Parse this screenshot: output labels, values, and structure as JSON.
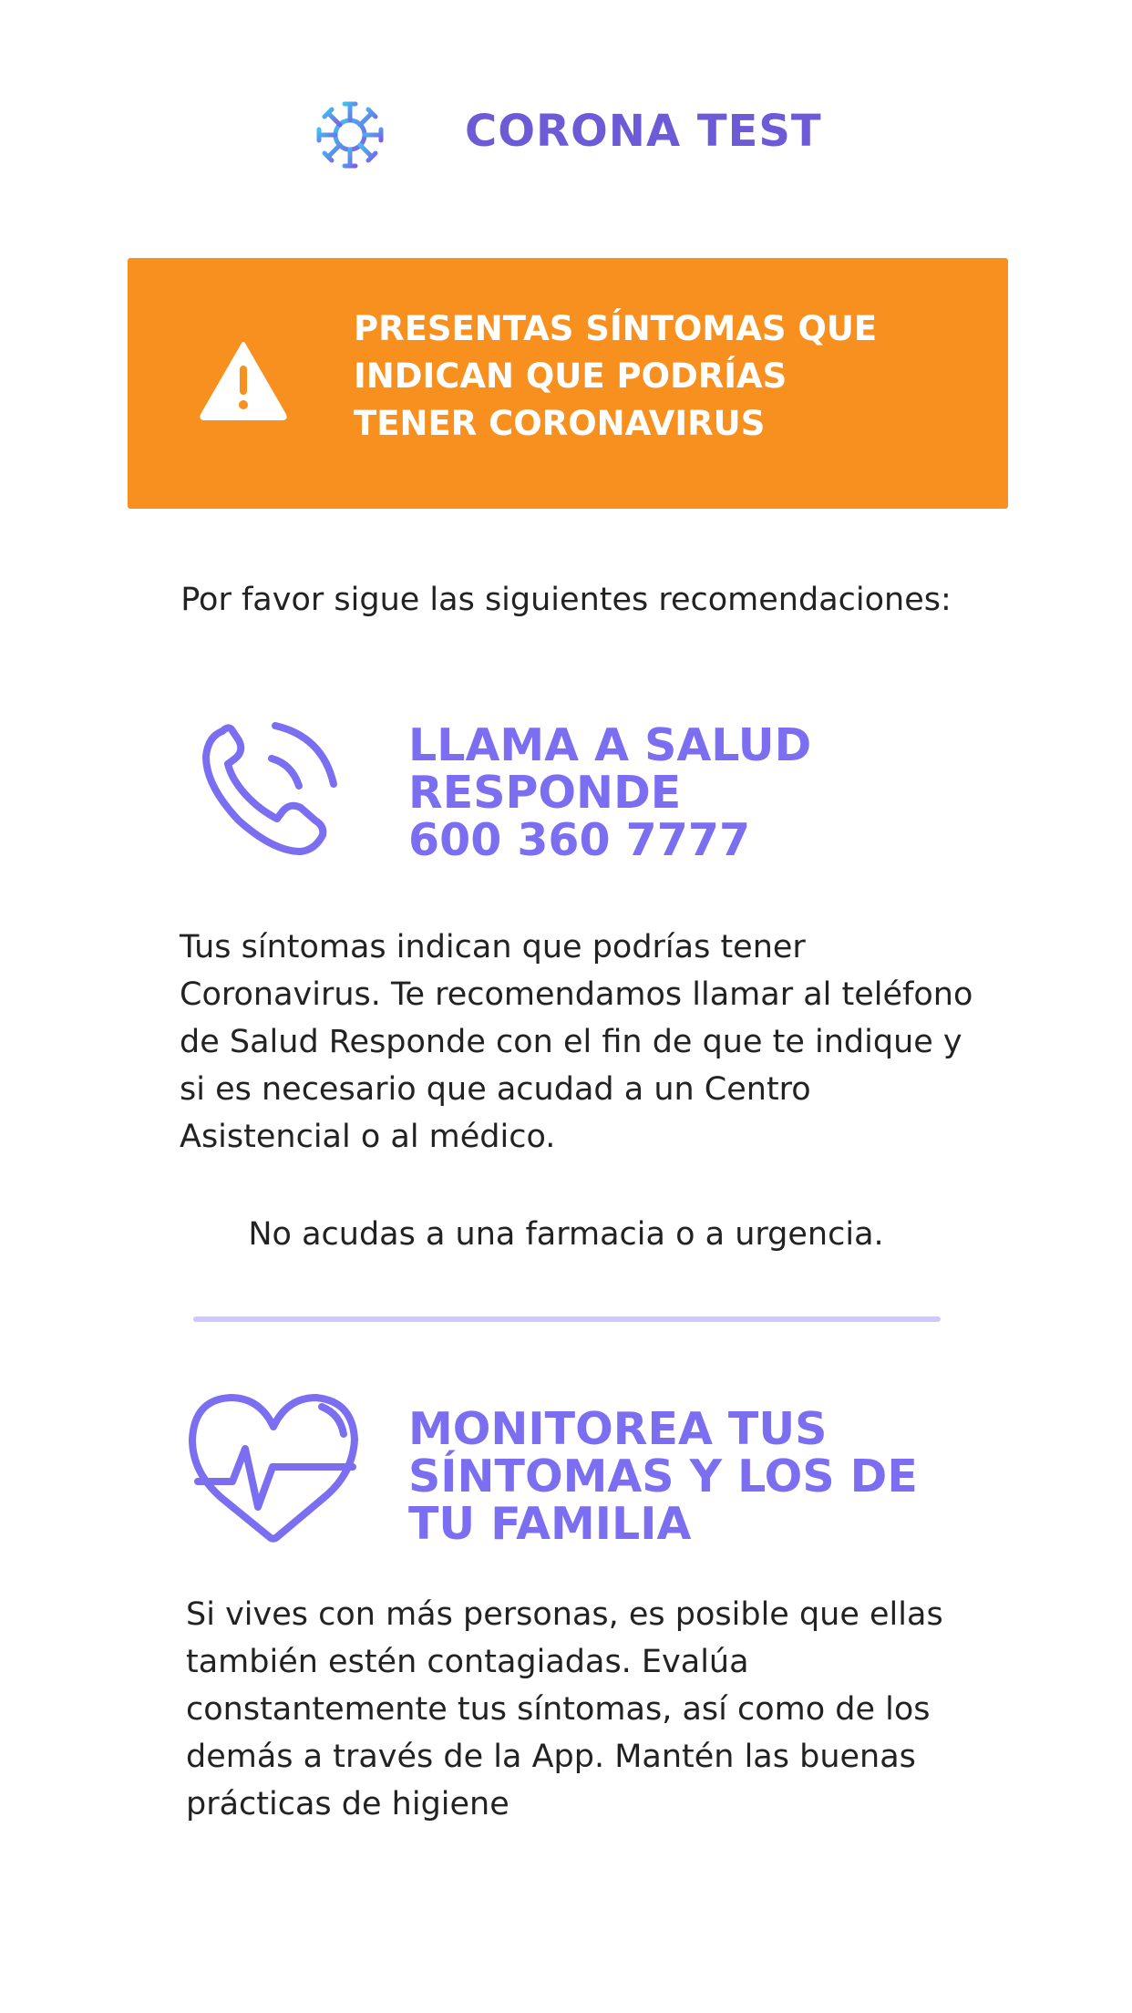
{
  "header": {
    "logo_icon": "virus-icon",
    "title": "CORONA TEST",
    "title_color": "#6c5ad6"
  },
  "alert": {
    "icon": "warning-triangle-icon",
    "message": "PRESENTAS SÍNTOMAS QUE\nINDICAN QUE PODRÍAS\nTENER CORONAVIRUS",
    "background_color": "#f7901f"
  },
  "intro": "Por favor sigue las siguientes recomendaciones:",
  "recommendations": [
    {
      "icon": "phone-call-icon",
      "title": "LLAMA A SALUD\nRESPONDE\n600 360 7777",
      "description": "Tus síntomas indican que podrías tener Coronavirus. Te recomendamos llamar al teléfono de Salud Responde con el fin de que te indique y si es necesario que acudad a un Centro Asistencial o al médico.",
      "note": "No acudas a una farmacia o a urgencia."
    },
    {
      "icon": "heart-pulse-icon",
      "title": "MONITOREA TUS\nSÍNTOMAS Y LOS DE\nTU FAMILIA",
      "description": "Si vives con más personas, es posible que ellas también estén contagiadas. Evalúa constantemente tus síntomas, así como de los demás a través de la App. Mantén las buenas prácticas de higiene"
    }
  ],
  "accent_color": "#7b6ef1"
}
